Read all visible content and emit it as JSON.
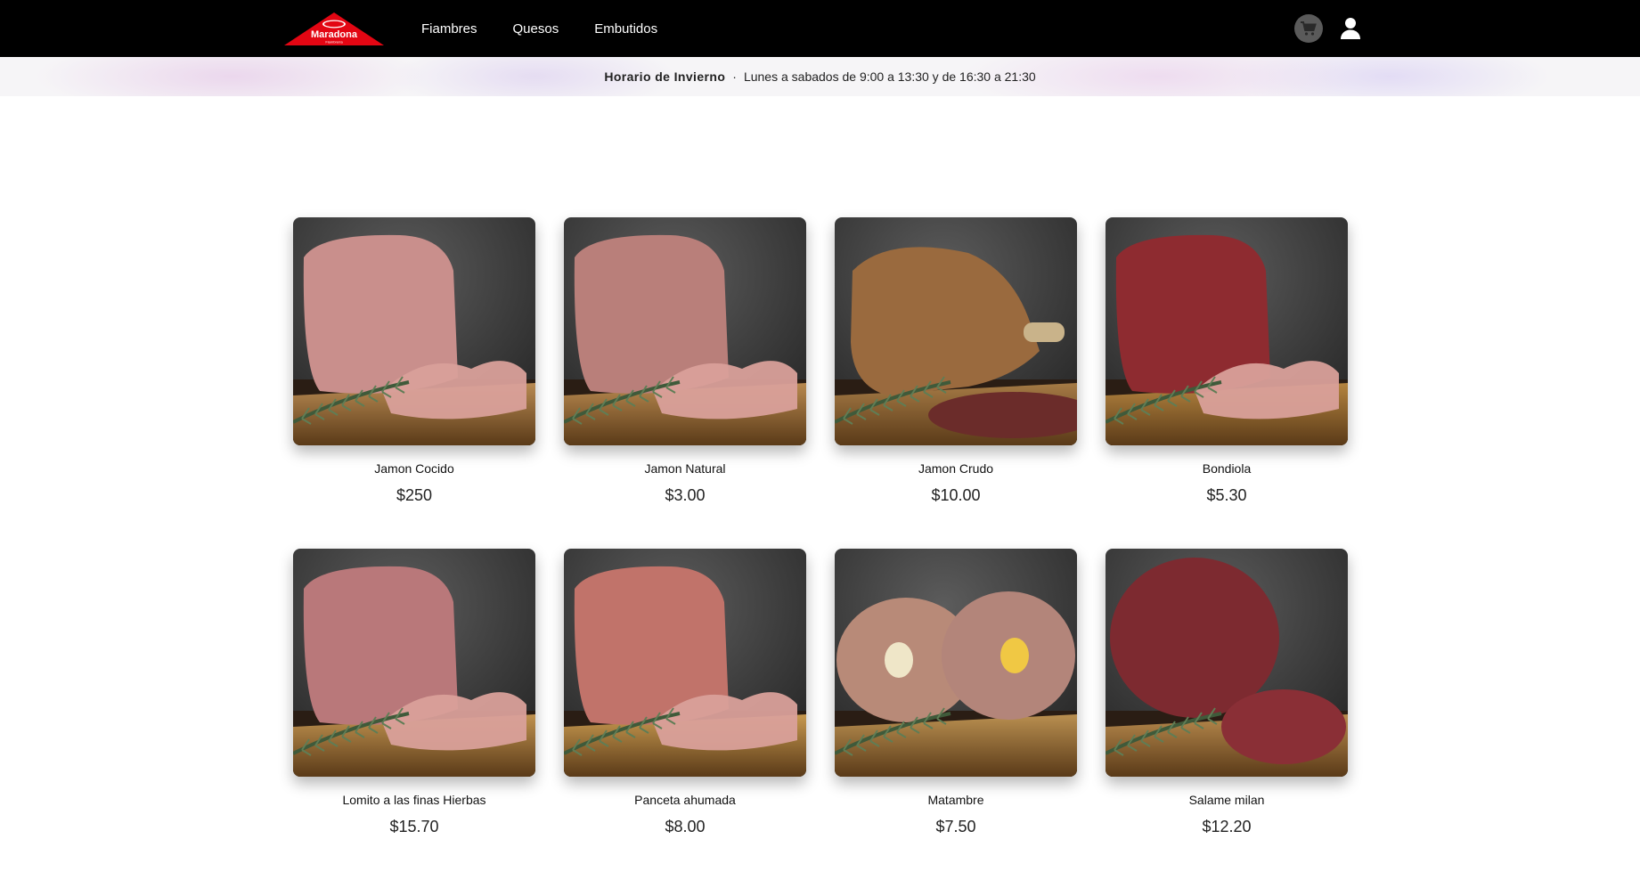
{
  "header": {
    "logo": {
      "brand": "Maradona",
      "badge": "Fiambrería"
    },
    "nav": [
      "Fiambres",
      "Quesos",
      "Embutidos"
    ],
    "icons": {
      "cart": "cart-icon",
      "user": "user-icon"
    },
    "colors": {
      "bar": "#000000",
      "logo_red": "#e30613"
    }
  },
  "hours_banner": {
    "title": "Horario de Invierno",
    "separator": "·",
    "text": "Lunes a sabados de 9:00 a 13:30 y de 16:30 a 21:30"
  },
  "products": [
    {
      "name": "Jamon Cocido",
      "price": "$250",
      "meat": "#c98f8c",
      "board": "#b88a52"
    },
    {
      "name": "Jamon Natural",
      "price": "$3.00",
      "meat": "#b97f7a",
      "board": "#b8894f"
    },
    {
      "name": "Jamon Crudo",
      "price": "$10.00",
      "meat": "#9a6a3e",
      "board": "#a57a45"
    },
    {
      "name": "Bondiola",
      "price": "$5.30",
      "meat": "#8e2b30",
      "board": "#b4843f"
    },
    {
      "name": "Lomito a las finas Hierbas",
      "price": "$15.70",
      "meat": "#b9787a",
      "board": "#c0924f"
    },
    {
      "name": "Panceta ahumada",
      "price": "$8.00",
      "meat": "#c1736a",
      "board": "#c7994f"
    },
    {
      "name": "Matambre",
      "price": "$7.50",
      "meat": "#b88a78",
      "board": "#b98f50"
    },
    {
      "name": "Salame milan",
      "price": "$12.20",
      "meat": "#7d2a30",
      "board": "#b88a4d"
    }
  ]
}
